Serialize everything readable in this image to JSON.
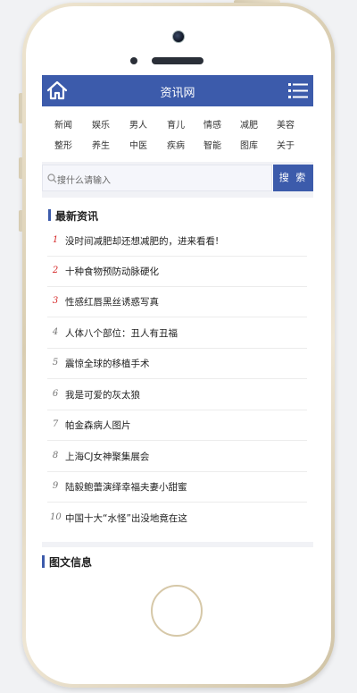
{
  "header": {
    "title": "资讯网",
    "home_icon": "home-icon",
    "menu_icon": "menu-icon"
  },
  "categories": [
    [
      "新闻",
      "娱乐",
      "男人",
      "育儿",
      "情感",
      "减肥",
      "美容"
    ],
    [
      "整形",
      "养生",
      "中医",
      "疾病",
      "智能",
      "图库",
      "关于"
    ]
  ],
  "search": {
    "placeholder": "搜什么请输入",
    "button": "搜 索"
  },
  "latest": {
    "title": "最新资讯",
    "items": [
      {
        "num": "1",
        "title": "没时间减肥却还想减肥的，进来看看!"
      },
      {
        "num": "2",
        "title": "十种食物预防动脉硬化"
      },
      {
        "num": "3",
        "title": "性感红唇黑丝诱惑写真"
      },
      {
        "num": "4",
        "title": "人体八个部位：丑人有丑福"
      },
      {
        "num": "5",
        "title": "震惊全球的移植手术"
      },
      {
        "num": "6",
        "title": "我是可爱的灰太狼"
      },
      {
        "num": "7",
        "title": "帕金森病人图片"
      },
      {
        "num": "8",
        "title": "上海CJ女神聚集展会"
      },
      {
        "num": "9",
        "title": "陆毅鲍蕾演绎幸福夫妻小甜蜜"
      },
      {
        "num": "10",
        "title": "中国十大“水怪”出没地竟在这"
      }
    ]
  },
  "pictures": {
    "title": "图文信息"
  },
  "colors": {
    "brand": "#3c5bab",
    "top_rank": "#d62b2b"
  }
}
